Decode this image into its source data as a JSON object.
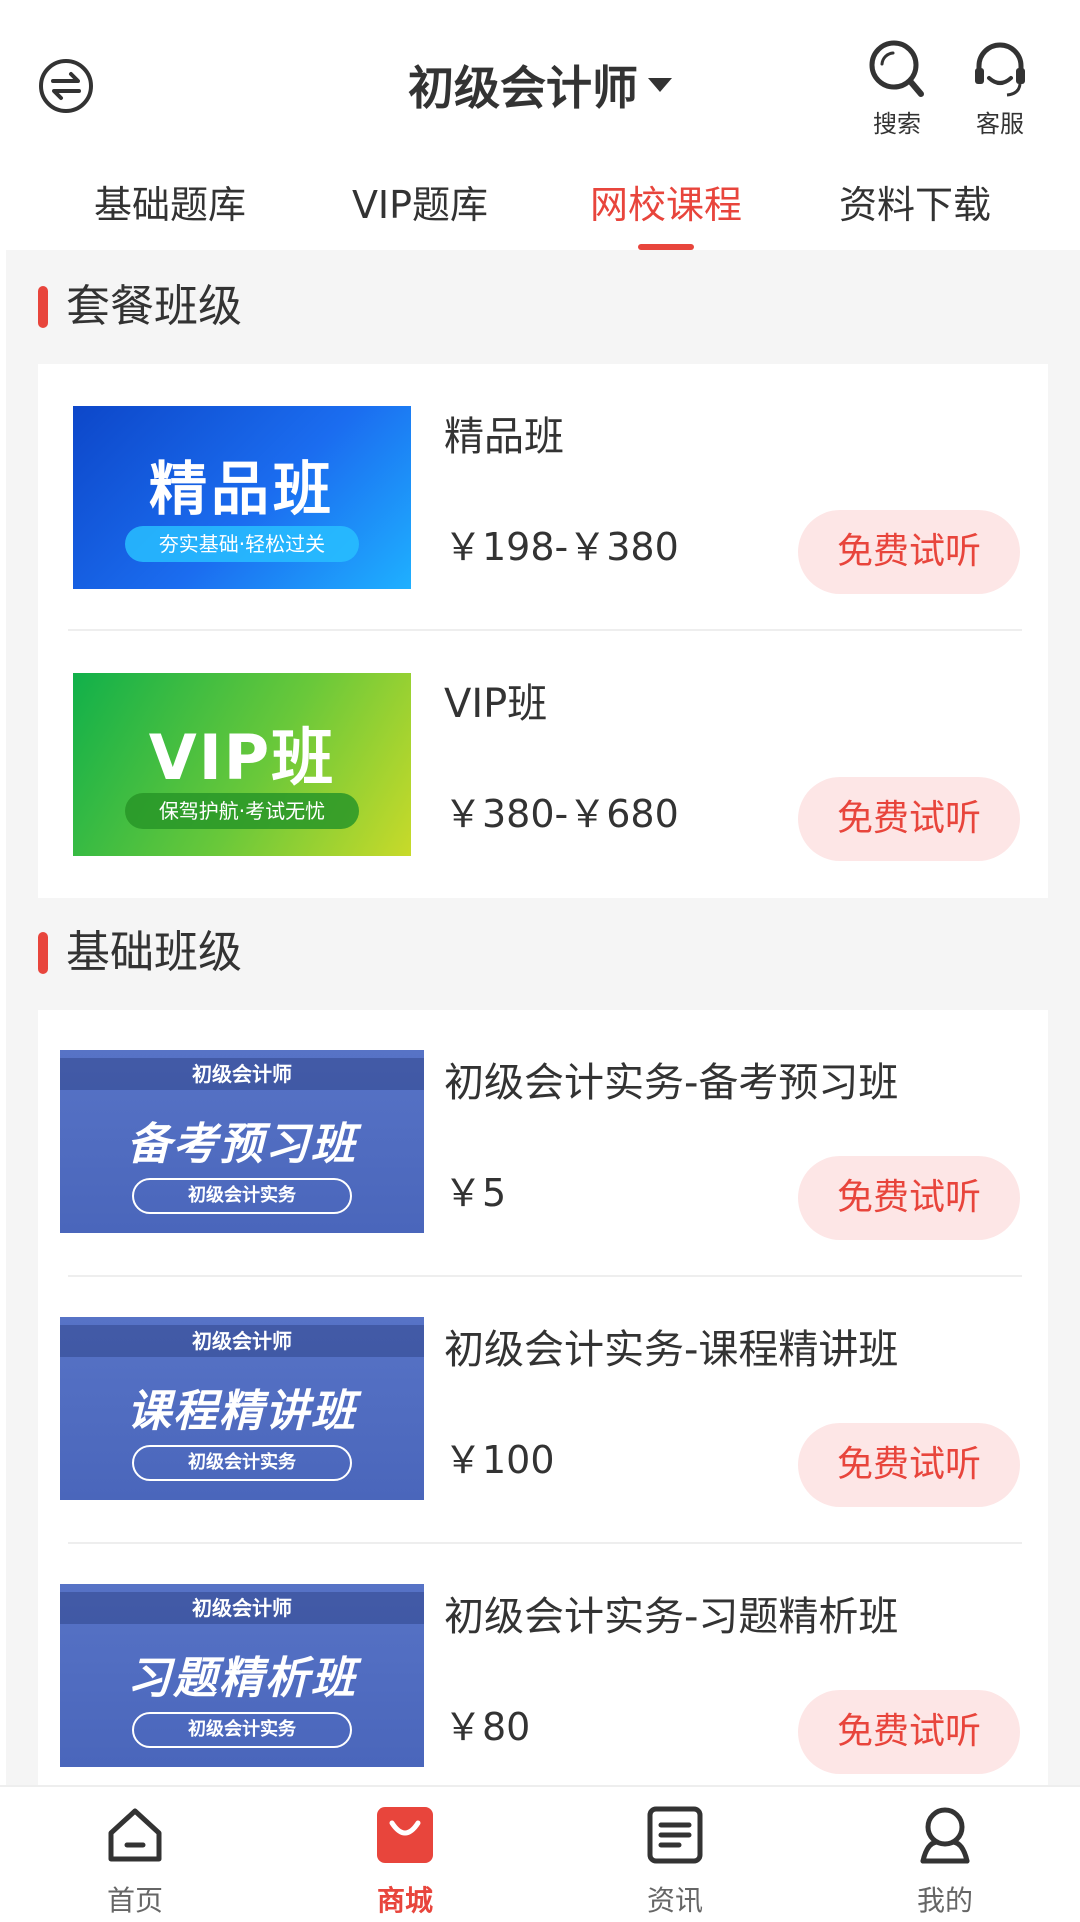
{
  "header": {
    "title": "初级会计师",
    "search_label": "搜索",
    "service_label": "客服"
  },
  "tabs": [
    {
      "label": "基础题库",
      "active": false
    },
    {
      "label": "VIP题库",
      "active": false
    },
    {
      "label": "网校课程",
      "active": true
    },
    {
      "label": "资料下载",
      "active": false
    }
  ],
  "sections": [
    {
      "title": "套餐班级",
      "items": [
        {
          "name": "精品班",
          "price": "￥198-￥380",
          "trial": "免费试听",
          "thumb": {
            "title": "精品班",
            "tagline": "夯实基础·轻松过关"
          }
        },
        {
          "name": "VIP班",
          "price": "￥380-￥680",
          "trial": "免费试听",
          "thumb": {
            "title": "VIP班",
            "tagline": "保驾护航·考试无忧"
          }
        }
      ]
    },
    {
      "title": "基础班级",
      "items": [
        {
          "name": "初级会计实务-备考预习班",
          "price": "￥5",
          "trial": "免费试听",
          "thumb": {
            "top": "初级会计师",
            "title": "备考预习班",
            "pill": "初级会计实务"
          }
        },
        {
          "name": "初级会计实务-课程精讲班",
          "price": "￥100",
          "trial": "免费试听",
          "thumb": {
            "top": "初级会计师",
            "title": "课程精讲班",
            "pill": "初级会计实务"
          }
        },
        {
          "name": "初级会计实务-习题精析班",
          "price": "￥80",
          "trial": "免费试听",
          "thumb": {
            "top": "初级会计师",
            "title": "习题精析班",
            "pill": "初级会计实务"
          }
        }
      ]
    }
  ],
  "bottom_nav": [
    {
      "label": "首页",
      "icon": "home-icon",
      "active": false
    },
    {
      "label": "商城",
      "icon": "shopping-bag-icon",
      "active": true
    },
    {
      "label": "资讯",
      "icon": "news-icon",
      "active": false
    },
    {
      "label": "我的",
      "icon": "profile-icon",
      "active": false
    }
  ],
  "colors": {
    "accent": "#e8453c",
    "trial_bg": "#fde6e6",
    "page_bg": "#f5f5f5"
  }
}
